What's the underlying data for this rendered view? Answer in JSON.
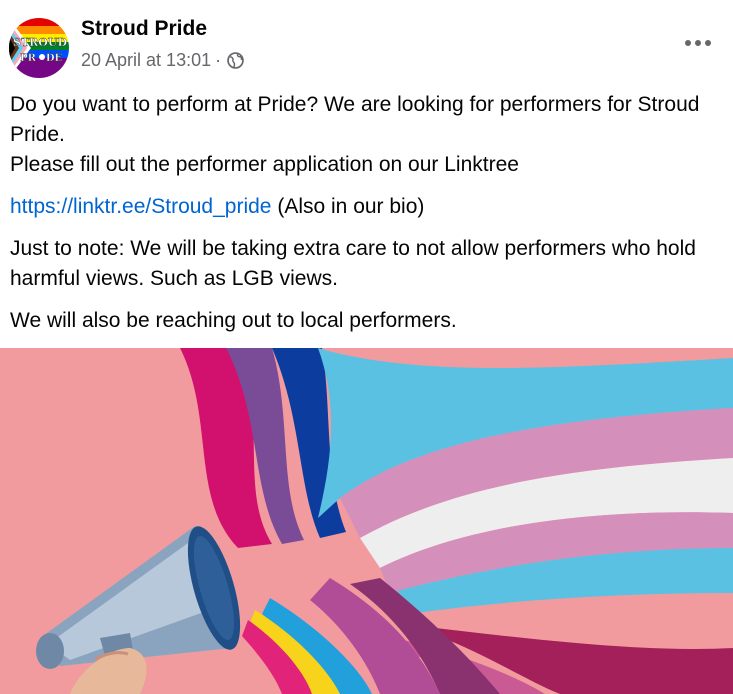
{
  "post": {
    "page_name": "Stroud Pride",
    "timestamp": "20 April at 13:01",
    "separator": "·",
    "privacy_icon": "globe-icon",
    "more_icon": "more-options-icon",
    "avatar_text_top": "STROUD",
    "avatar_text_bottom": "PR",
    "avatar_text_bottom_end": "DE",
    "body": {
      "line1": "Do you want to perform at Pride? We are looking for performers for Stroud Pride.",
      "line2": "Please fill out the performer application on our Linktree",
      "link": "https://linktr.ee/Stroud_pride",
      "link_suffix": " (Also in our bio)",
      "note": "Just to note: We will be taking extra care to not allow performers who hold harmful views. Such as LGB views.",
      "closing": "We will also be reaching out to local performers."
    },
    "colors": {
      "link": "#0064d1",
      "meta": "#65676b",
      "text": "#050505",
      "image_background": "#f29b9e"
    }
  }
}
